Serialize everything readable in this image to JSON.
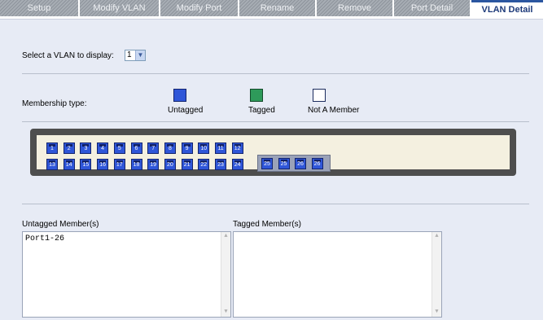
{
  "tabs": [
    {
      "label": "Setup"
    },
    {
      "label": "Modify VLAN"
    },
    {
      "label": "Modify Port"
    },
    {
      "label": "Rename"
    },
    {
      "label": "Remove"
    },
    {
      "label": "Port Detail"
    },
    {
      "label": "VLAN Detail"
    }
  ],
  "active_tab": "VLAN Detail",
  "vlan_select": {
    "label": "Select a VLAN to display:",
    "value": "1"
  },
  "membership": {
    "label": "Membership type:",
    "types": [
      {
        "label": "Untagged",
        "color": "#2f56d8"
      },
      {
        "label": "Tagged",
        "color": "#2e9a5a"
      },
      {
        "label": "Not A Member",
        "color": "#ffffff"
      }
    ]
  },
  "ports_top": [
    "1",
    "2",
    "3",
    "4",
    "5",
    "6",
    "7",
    "8",
    "9",
    "10",
    "11",
    "12"
  ],
  "ports_bottom": [
    "13",
    "14",
    "15",
    "16",
    "17",
    "18",
    "19",
    "20",
    "21",
    "22",
    "23",
    "24"
  ],
  "ports_uplink": [
    "25",
    "25",
    "26",
    "26"
  ],
  "untagged": {
    "label": "Untagged Member(s)",
    "value": "Port1-26"
  },
  "tagged": {
    "label": "Tagged Member(s)",
    "value": ""
  },
  "colors": {
    "untagged": "#2f56d8",
    "tagged": "#2e9a5a",
    "panel": "#e7ebf5",
    "accent": "#2b56a0"
  }
}
